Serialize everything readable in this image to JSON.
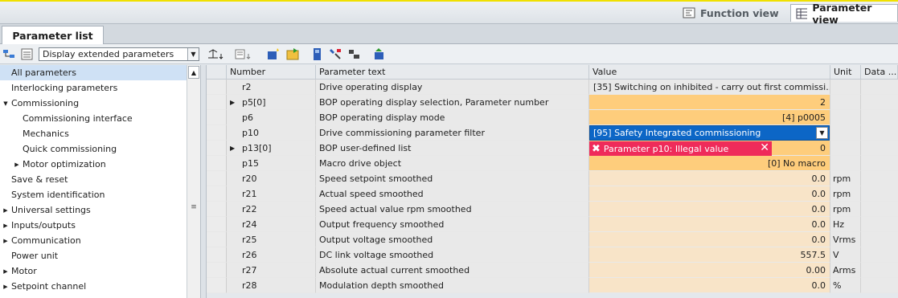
{
  "views": {
    "function_view": "Function view",
    "parameter_view": "Parameter view"
  },
  "tab": {
    "label": "Parameter list"
  },
  "toolbar": {
    "filter_select": "Display extended parameters"
  },
  "nav": {
    "items": [
      {
        "label": "All parameters",
        "indent": 0,
        "expander": "",
        "selected": true
      },
      {
        "label": "Interlocking parameters",
        "indent": 0,
        "expander": ""
      },
      {
        "label": "Commissioning",
        "indent": 0,
        "expander": "▼"
      },
      {
        "label": "Commissioning interface",
        "indent": 1,
        "expander": ""
      },
      {
        "label": "Mechanics",
        "indent": 1,
        "expander": ""
      },
      {
        "label": "Quick commissioning",
        "indent": 1,
        "expander": ""
      },
      {
        "label": "Motor optimization",
        "indent": 1,
        "expander": "▶"
      },
      {
        "label": "Save & reset",
        "indent": 0,
        "expander": ""
      },
      {
        "label": "System identification",
        "indent": 0,
        "expander": ""
      },
      {
        "label": "Universal settings",
        "indent": 0,
        "expander": "▶"
      },
      {
        "label": "Inputs/outputs",
        "indent": 0,
        "expander": "▶"
      },
      {
        "label": "Communication",
        "indent": 0,
        "expander": "▶"
      },
      {
        "label": "Power unit",
        "indent": 0,
        "expander": ""
      },
      {
        "label": "Motor",
        "indent": 0,
        "expander": "▶"
      },
      {
        "label": "Setpoint channel",
        "indent": 0,
        "expander": "▶"
      }
    ]
  },
  "grid": {
    "columns": [
      "Number",
      "Parameter text",
      "Value",
      "Unit",
      "Data ..."
    ],
    "rows": [
      {
        "number": "r2",
        "text": "Drive operating display",
        "value": "[35] Switching on inhibited - carry out first commissi...",
        "unit": "",
        "expander": "",
        "style": "gray"
      },
      {
        "number": "p5[0]",
        "text": "BOP operating display selection, Parameter number",
        "value": "2",
        "unit": "",
        "expander": "▶",
        "style": "orange"
      },
      {
        "number": "p6",
        "text": "BOP operating display mode",
        "value": "[4] p0005",
        "unit": "",
        "expander": "",
        "style": "orange"
      },
      {
        "number": "p10",
        "text": "Drive commissioning parameter filter",
        "value": "",
        "unit": "",
        "expander": "",
        "style": "orange"
      },
      {
        "number": "p13[0]",
        "text": "BOP user-defined list",
        "value": "0",
        "unit": "",
        "expander": "▶",
        "style": "orange"
      },
      {
        "number": "p15",
        "text": "Macro drive object",
        "value": "[0] No macro",
        "unit": "",
        "expander": "",
        "style": "orange"
      },
      {
        "number": "r20",
        "text": "Speed setpoint smoothed",
        "value": "0.0",
        "unit": "rpm",
        "expander": "",
        "style": "light"
      },
      {
        "number": "r21",
        "text": "Actual speed smoothed",
        "value": "0.0",
        "unit": "rpm",
        "expander": "",
        "style": "light"
      },
      {
        "number": "r22",
        "text": "Speed actual value rpm smoothed",
        "value": "0.0",
        "unit": "rpm",
        "expander": "",
        "style": "light"
      },
      {
        "number": "r24",
        "text": "Output frequency smoothed",
        "value": "0.0",
        "unit": "Hz",
        "expander": "",
        "style": "light"
      },
      {
        "number": "r25",
        "text": "Output voltage smoothed",
        "value": "0.0",
        "unit": "Vrms",
        "expander": "",
        "style": "light"
      },
      {
        "number": "r26",
        "text": "DC link voltage smoothed",
        "value": "557.5",
        "unit": "V",
        "expander": "",
        "style": "light"
      },
      {
        "number": "r27",
        "text": "Absolute actual current smoothed",
        "value": "0.00",
        "unit": "Arms",
        "expander": "",
        "style": "light"
      },
      {
        "number": "r28",
        "text": "Modulation depth smoothed",
        "value": "0.0",
        "unit": "%",
        "expander": "",
        "style": "light"
      }
    ]
  },
  "dropdown": {
    "value": "[95] Safety Integrated commissioning"
  },
  "error": {
    "message": "Parameter p10: Illegal value"
  },
  "colors": {
    "accent": "#0c66c6",
    "error": "#ef2b5a",
    "edit_orange": "#fecd7c",
    "readonly": "#f8e4c8"
  }
}
